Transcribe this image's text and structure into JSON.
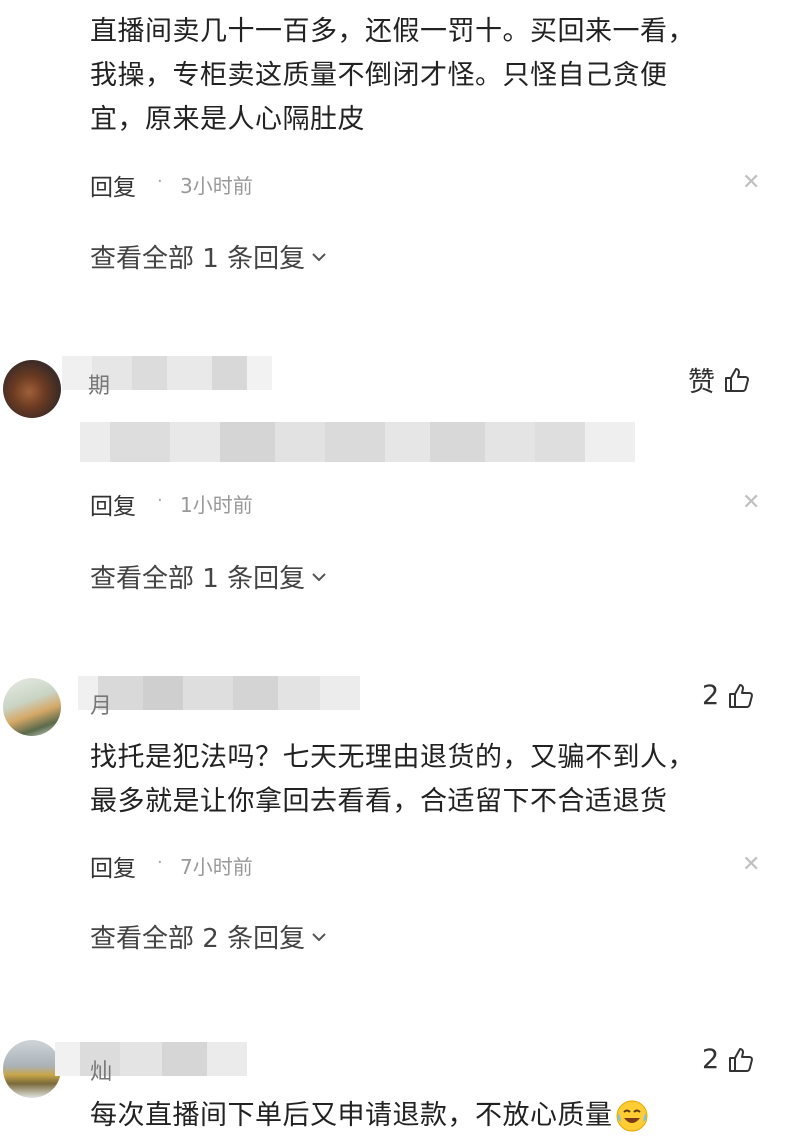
{
  "comments": [
    {
      "text_lines": [
        "直播间卖几十一百多，还假一罚十。买回来一看，",
        "我操，专柜卖这质量不倒闭才怪。只怪自己贪便",
        "宜，原来是人心隔肚皮"
      ],
      "reply_label": "回复",
      "separator": "·",
      "time": "3小时前",
      "view_all": "查看全部 1 条回复"
    },
    {
      "username_fragment": "期",
      "like_label": "赞",
      "reply_label": "回复",
      "separator": "·",
      "time": "1小时前",
      "view_all": "查看全部 1 条回复"
    },
    {
      "username_fragment": "月",
      "like_count": "2",
      "text_lines": [
        "找托是犯法吗？七天无理由退货的，又骗不到人，",
        "最多就是让你拿回去看看，合适留下不合适退货"
      ],
      "reply_label": "回复",
      "separator": "·",
      "time": "7小时前",
      "view_all": "查看全部 2 条回复"
    },
    {
      "username_fragment": "灿",
      "like_count": "2",
      "text_lines": [
        "每次直播间下单后又申请退款，不放心质量"
      ],
      "emoji": "crying-laughing-emoji"
    }
  ],
  "icons": {
    "like": "thumbs-up-icon",
    "close": "close-icon",
    "expand": "chevron-down-icon"
  }
}
